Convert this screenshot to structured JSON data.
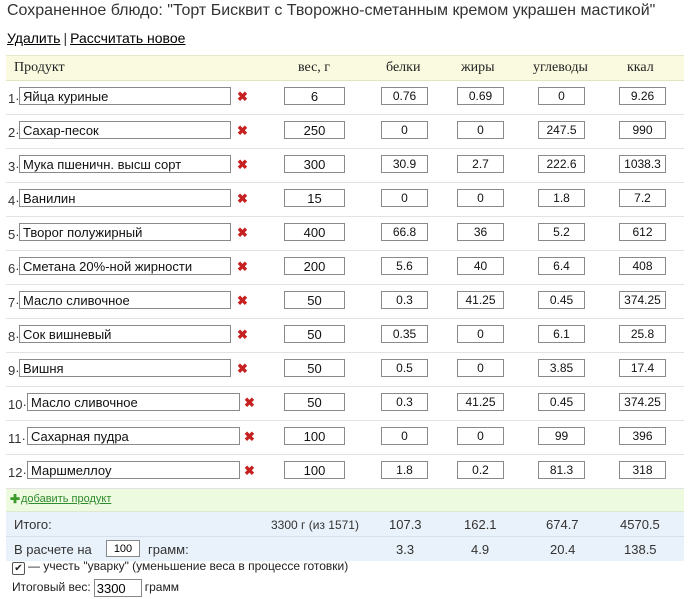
{
  "title": "Сохраненное блюдо: \"Торт Бисквит с Творожно-сметанным кремом украшен мастикой\"",
  "actions": {
    "delete": "Удалить",
    "separator": "|",
    "recalc": "Рассчитать новое"
  },
  "columns": {
    "product": "Продукт",
    "weight": "вес, г",
    "protein": "белки",
    "fat": "жиры",
    "carbs": "углеводы",
    "kcal": "ккал"
  },
  "rows": [
    {
      "num": "1·",
      "name": "Яйца куриные",
      "weight": "6",
      "protein": "0.76",
      "fat": "0.69",
      "carbs": "0",
      "kcal": "9.26"
    },
    {
      "num": "2·",
      "name": "Сахар-песок",
      "weight": "250",
      "protein": "0",
      "fat": "0",
      "carbs": "247.5",
      "kcal": "990"
    },
    {
      "num": "3·",
      "name": "Мука пшеничн. высш сорт",
      "weight": "300",
      "protein": "30.9",
      "fat": "2.7",
      "carbs": "222.6",
      "kcal": "1038.3"
    },
    {
      "num": "4·",
      "name": "Ванилин",
      "weight": "15",
      "protein": "0",
      "fat": "0",
      "carbs": "1.8",
      "kcal": "7.2"
    },
    {
      "num": "5·",
      "name": "Творог полужирный",
      "weight": "400",
      "protein": "66.8",
      "fat": "36",
      "carbs": "5.2",
      "kcal": "612"
    },
    {
      "num": "6·",
      "name": "Сметана 20%-ной жирности",
      "weight": "200",
      "protein": "5.6",
      "fat": "40",
      "carbs": "6.4",
      "kcal": "408"
    },
    {
      "num": "7·",
      "name": "Масло сливочное",
      "weight": "50",
      "protein": "0.3",
      "fat": "41.25",
      "carbs": "0.45",
      "kcal": "374.25"
    },
    {
      "num": "8·",
      "name": "Сок вишневый",
      "weight": "50",
      "protein": "0.35",
      "fat": "0",
      "carbs": "6.1",
      "kcal": "25.8"
    },
    {
      "num": "9·",
      "name": "Вишня",
      "weight": "50",
      "protein": "0.5",
      "fat": "0",
      "carbs": "3.85",
      "kcal": "17.4"
    },
    {
      "num": "10·",
      "name": "Масло сливочное",
      "weight": "50",
      "protein": "0.3",
      "fat": "41.25",
      "carbs": "0.45",
      "kcal": "374.25"
    },
    {
      "num": "11·",
      "name": "Сахарная пудра",
      "weight": "100",
      "protein": "0",
      "fat": "0",
      "carbs": "99",
      "kcal": "396"
    },
    {
      "num": "12·",
      "name": "Маршмеллоу",
      "weight": "100",
      "protein": "1.8",
      "fat": "0.2",
      "carbs": "81.3",
      "kcal": "318"
    }
  ],
  "add_product": "добавить продукт",
  "totals": {
    "label": "Итого:",
    "weight": "3300 г (из 1571)",
    "protein": "107.3",
    "fat": "162.1",
    "carbs": "674.7",
    "kcal": "4570.5"
  },
  "per": {
    "prefix": "В расчете на",
    "amount": "100",
    "suffix": "грамм:",
    "protein": "3.3",
    "fat": "4.9",
    "carbs": "20.4",
    "kcal": "138.5"
  },
  "cooking_loss": {
    "checked": true,
    "label": "— учесть \"уварку\" (уменьшение веса в процессе готовки)"
  },
  "final_weight": {
    "label": "Итоговый вес:",
    "value": "3300",
    "unit": "грамм"
  },
  "icons": {
    "delete": "delete-x-icon",
    "add": "plus-icon",
    "checkbox": "checkmark-icon"
  },
  "colors": {
    "header_bg": "#fafae0",
    "totals_bg": "#e9f1fa",
    "add_bg": "#eefadf",
    "delete": "#c62020",
    "link_green": "#2e8b2e"
  }
}
